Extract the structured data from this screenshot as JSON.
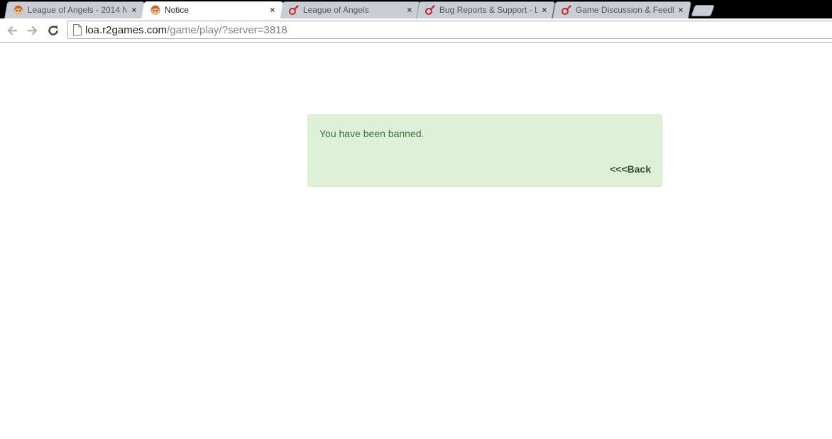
{
  "browser": {
    "tabs": [
      {
        "title": "League of Angels - 2014 N",
        "favicon": "angel-avatar-icon",
        "active": false
      },
      {
        "title": "Notice",
        "favicon": "angel-avatar-icon",
        "active": true
      },
      {
        "title": "League of Angels",
        "favicon": "r2-games-icon",
        "active": false
      },
      {
        "title": "Bug Reports & Support - L",
        "favicon": "r2-games-icon",
        "active": false
      },
      {
        "title": "Game Discussion & Feedb",
        "favicon": "r2-games-icon",
        "active": false
      }
    ],
    "close_glyph": "×",
    "address": {
      "host": "loa.r2games.com",
      "path": "/game/play/?server=3818"
    }
  },
  "notice": {
    "message": "You have been banned.",
    "back_label": "<<<Back"
  },
  "colors": {
    "alert_bg": "#dff0d8",
    "alert_border": "#d6e9c6",
    "alert_text": "#3c763d",
    "link_text": "#2b542c"
  }
}
